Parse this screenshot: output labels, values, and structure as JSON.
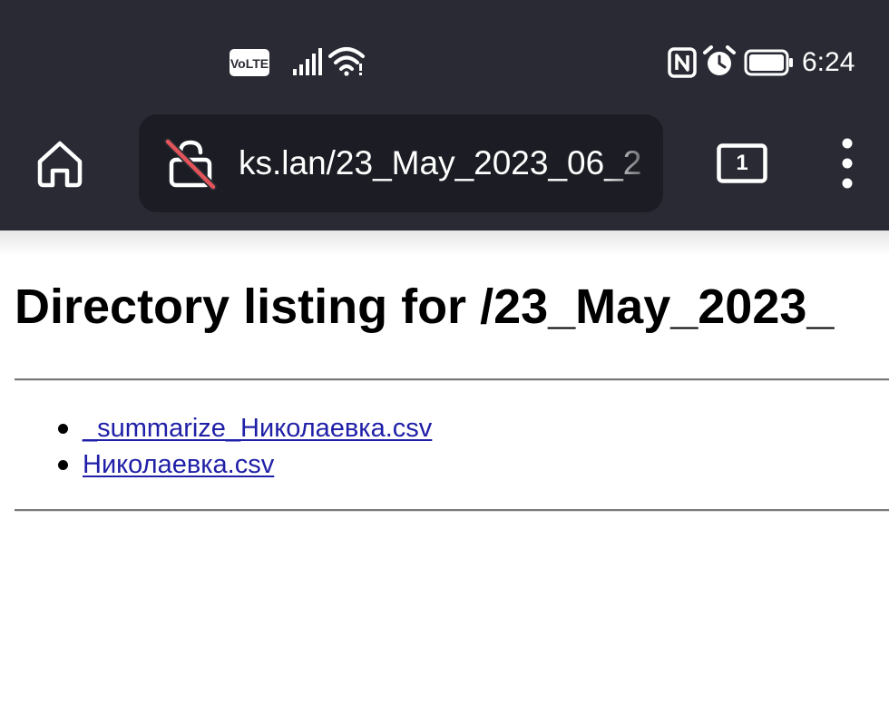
{
  "status_bar": {
    "volte_label": "VoLTE",
    "time": "6:24",
    "icons": [
      "volte-icon",
      "signal-icon",
      "wifi-icon",
      "nfc-icon",
      "alarm-icon",
      "battery-icon"
    ]
  },
  "toolbar": {
    "url": "ks.lan/23_May_2023_06_2",
    "tab_count": "1",
    "icons": [
      "home-icon",
      "insecure-lock-icon",
      "tabs-icon",
      "more-vert-icon"
    ]
  },
  "page": {
    "title": "Directory listing for /23_May_2023_",
    "files": [
      {
        "name": "_summarize_Николаевка.csv"
      },
      {
        "name": "Николаевка.csv"
      }
    ]
  },
  "colors": {
    "chrome_bg": "#292a33",
    "url_bar_bg": "#1c1d24",
    "link": "#1f1fa8",
    "insecure_slash": "#e0545a"
  }
}
